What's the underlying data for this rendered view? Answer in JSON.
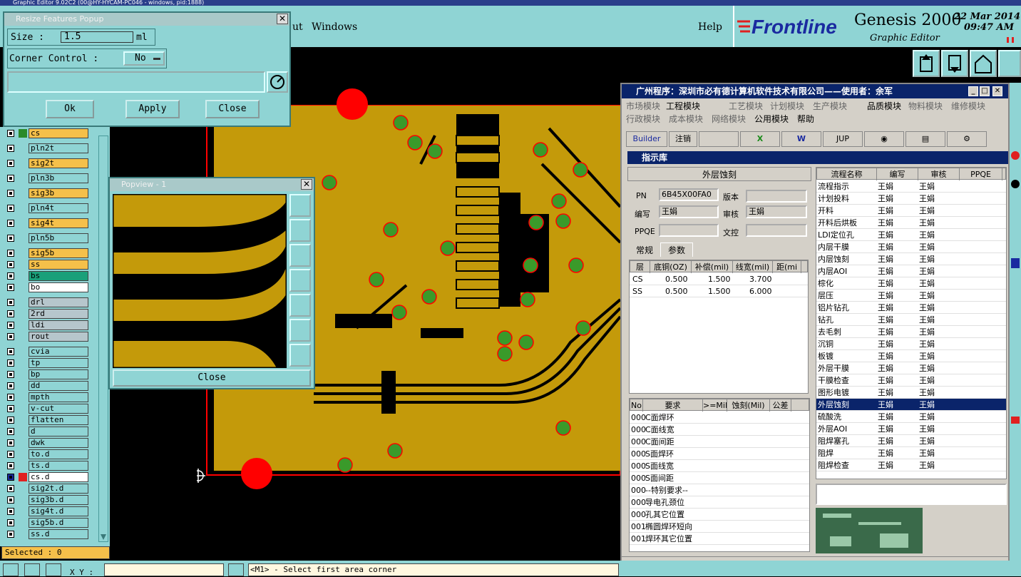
{
  "app_title": "Graphic Editor 9.02C2 (00@HY-HYCAM-PC046 - windows, pid:1888)",
  "menu": {
    "item1": "ut",
    "windows": "Windows",
    "help": "Help"
  },
  "brand": {
    "frontline": "Frontline",
    "genesis": "Genesis 2000",
    "subtitle": "Graphic Editor",
    "date": "22 Mar 2014",
    "time": "09:47 AM"
  },
  "resize_popup": {
    "title": "Resize Features Popup",
    "size_label": "Size :",
    "size_value": "1.5",
    "size_unit": "ml",
    "corner_label": "Corner Control :",
    "corner_value": "No",
    "ok": "Ok",
    "apply": "Apply",
    "close": "Close"
  },
  "popview": {
    "title": "Popview - 1",
    "close": "Close"
  },
  "layers": [
    {
      "name": "cs",
      "style": "sig",
      "swatch": "#2a8a2a"
    },
    {
      "name": "pln2t",
      "style": ""
    },
    {
      "name": "sig2t",
      "style": "sig"
    },
    {
      "name": "pln3b",
      "style": ""
    },
    {
      "name": "sig3b",
      "style": "sig"
    },
    {
      "name": "pln4t",
      "style": ""
    },
    {
      "name": "sig4t",
      "style": "sig"
    },
    {
      "name": "pln5b",
      "style": ""
    },
    {
      "name": "sig5b",
      "style": "sig"
    },
    {
      "name": "ss",
      "style": "sig"
    },
    {
      "name": "bs",
      "style": "green"
    },
    {
      "name": "bo",
      "style": "white"
    },
    {
      "name": "drl",
      "style": "grey"
    },
    {
      "name": "2rd",
      "style": "grey"
    },
    {
      "name": "ldi",
      "style": "grey"
    },
    {
      "name": "rout",
      "style": "grey"
    },
    {
      "name": "cvia",
      "style": ""
    },
    {
      "name": "tp",
      "style": ""
    },
    {
      "name": "bp",
      "style": ""
    },
    {
      "name": "dd",
      "style": ""
    },
    {
      "name": "mpth",
      "style": ""
    },
    {
      "name": "v-cut",
      "style": ""
    },
    {
      "name": "flatten",
      "style": ""
    },
    {
      "name": "d",
      "style": ""
    },
    {
      "name": "dwk",
      "style": ""
    },
    {
      "name": "to.d",
      "style": ""
    },
    {
      "name": "ts.d",
      "style": ""
    },
    {
      "name": "cs.d",
      "style": "white",
      "swatch": "#e02020",
      "sel": true
    },
    {
      "name": "sig2t.d",
      "style": ""
    },
    {
      "name": "sig3b.d",
      "style": ""
    },
    {
      "name": "sig4t.d",
      "style": ""
    },
    {
      "name": "sig5b.d",
      "style": ""
    },
    {
      "name": "ss.d",
      "style": ""
    }
  ],
  "selected_label": "Selected : 0",
  "status": {
    "xy_label": "X Y :",
    "prompt": "<M1> - Select first area corner"
  },
  "erp": {
    "title": "广州程序：深圳市必有德计算机软件技术有限公司——使用者：余军",
    "menu_row1": [
      "市场模块",
      "工程模块",
      "工艺模块",
      "计划模块",
      "生产模块",
      "品质模块",
      "物料模块",
      "维修模块"
    ],
    "menu_row2": [
      "行政模块",
      "成本模块",
      "网络模块",
      "公用模块",
      "帮助"
    ],
    "toolbar": [
      "Builder",
      "注销",
      "JUP"
    ],
    "sub_title": "指示库",
    "process_name": "外层蚀刻",
    "pn_label": "PN",
    "pn_value": "6B45X00FA0",
    "version_label": "版本",
    "version_value": "",
    "author_label": "编写",
    "author_value": "王娟",
    "review_label": "审核",
    "review_value": "王娟",
    "ppqe_label": "PPQE",
    "ppqe_value": "",
    "doc_label": "文控",
    "doc_value": "",
    "tabs": [
      "常规",
      "参数"
    ],
    "param_headers": [
      "层",
      "底铜(OZ)",
      "补偿(mil)",
      "线宽(mil)",
      "距(mi"
    ],
    "param_rows": [
      [
        "CS",
        "0.500",
        "1.500",
        "3.700"
      ],
      [
        "SS",
        "0.500",
        "1.500",
        "6.000"
      ]
    ],
    "req_headers": [
      "No",
      "要求",
      ">=Mil",
      "蚀刻(Mil)",
      "公差"
    ],
    "req_rows": [
      [
        "000",
        "C面焊环"
      ],
      [
        "000",
        "C面线宽"
      ],
      [
        "000",
        "C面间距"
      ],
      [
        "000",
        "S面焊环"
      ],
      [
        "000",
        "S面线宽"
      ],
      [
        "000",
        "S面间距"
      ],
      [
        "000",
        "--特别要求--"
      ],
      [
        "000",
        "导电孔颈位"
      ],
      [
        "000",
        "孔其它位置"
      ],
      [
        "001",
        "椭圆焊环短向"
      ],
      [
        "001",
        "焊环其它位置"
      ]
    ],
    "flow_headers": [
      "流程名称",
      "编写",
      "审核",
      "PPQE"
    ],
    "flow_rows": [
      [
        "流程指示",
        "王娟",
        "王娟"
      ],
      [
        "计划投料",
        "王娟",
        "王娟"
      ],
      [
        "开料",
        "王娟",
        "王娟"
      ],
      [
        "开料后烘板",
        "王娟",
        "王娟"
      ],
      [
        "LDI定位孔",
        "王娟",
        "王娟"
      ],
      [
        "内层干膜",
        "王娟",
        "王娟"
      ],
      [
        "内层蚀刻",
        "王娟",
        "王娟"
      ],
      [
        "内层AOI",
        "王娟",
        "王娟"
      ],
      [
        "棕化",
        "王娟",
        "王娟"
      ],
      [
        "层压",
        "王娟",
        "王娟"
      ],
      [
        "铝片钻孔",
        "王娟",
        "王娟"
      ],
      [
        "钻孔",
        "王娟",
        "王娟"
      ],
      [
        "去毛刺",
        "王娟",
        "王娟"
      ],
      [
        "沉铜",
        "王娟",
        "王娟"
      ],
      [
        "板镀",
        "王娟",
        "王娟"
      ],
      [
        "外层干膜",
        "王娟",
        "王娟"
      ],
      [
        "干膜检查",
        "王娟",
        "王娟"
      ],
      [
        "图形电镀",
        "王娟",
        "王娟"
      ],
      [
        "外层蚀刻",
        "王娟",
        "王娟"
      ],
      [
        "硫酸洗",
        "王娟",
        "王娟"
      ],
      [
        "外层AOI",
        "王娟",
        "王娟"
      ],
      [
        "阻焊塞孔",
        "王娟",
        "王娟"
      ],
      [
        "阻焊",
        "王娟",
        "王娟"
      ],
      [
        "阻焊检查",
        "王娟",
        "王娟"
      ]
    ],
    "flow_selected": 18
  },
  "colors": {
    "teal": "#8fd4d4",
    "copper": "#c49a0a",
    "pad_green": "#3a9a2a",
    "outline_red": "#ff0000"
  }
}
